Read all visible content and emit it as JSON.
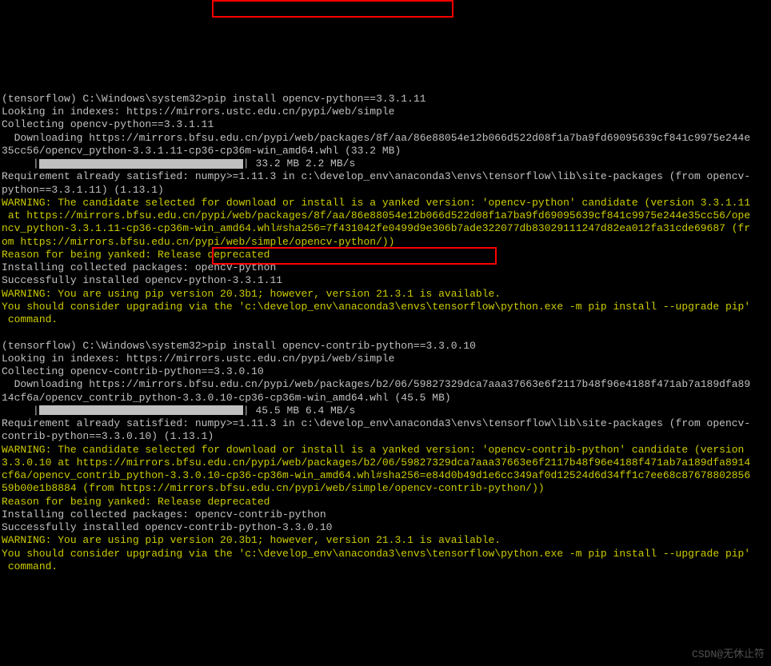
{
  "prompt1": "(tensorflow) C:\\Windows\\system32>",
  "cmd1": "pip install opencv-python==3.3.1.11",
  "lookup1": "Looking in indexes: https://mirrors.ustc.edu.cn/pypi/web/simple",
  "collect1": "Collecting opencv-python==3.3.1.11",
  "dl1a": "  Downloading https://mirrors.bfsu.edu.cn/pypi/web/packages/8f/aa/86e88054e12b066d522d08f1a7ba9fd69095639cf841c9975e244e",
  "dl1b": "35cc56/opencv_python-3.3.1.11-cp36-cp36m-win_amd64.whl (33.2 MB)",
  "prog1": " 33.2 MB 2.2 MB/s",
  "req1a": "Requirement already satisfied: numpy>=1.11.3 in c:\\develop_env\\anaconda3\\envs\\tensorflow\\lib\\site-packages (from opencv-",
  "req1b": "python==3.3.1.11) (1.13.1)",
  "warn1a": "WARNING: The candidate selected for download or install is a yanked version: 'opencv-python' candidate (version 3.3.1.11",
  "warn1b": " at https://mirrors.bfsu.edu.cn/pypi/web/packages/8f/aa/86e88054e12b066d522d08f1a7ba9fd69095639cf841c9975e244e35cc56/ope",
  "warn1c": "ncv_python-3.3.1.11-cp36-cp36m-win_amd64.whl#sha256=7f431042fe0499d9e306b7ade322077db83029111247d82ea012fa31cde69687 (fr",
  "warn1d": "om https://mirrors.bfsu.edu.cn/pypi/web/simple/opencv-python/))",
  "reason1": "Reason for being yanked: Release deprecated",
  "install1": "Installing collected packages: opencv-python",
  "success1": "Successfully installed opencv-python-3.3.1.11",
  "pipwarn1a": "WARNING: You are using pip version 20.3b1; however, version 21.3.1 is available.",
  "pipwarn1b": "You should consider upgrading via the 'c:\\develop_env\\anaconda3\\envs\\tensorflow\\python.exe -m pip install --upgrade pip'",
  "pipwarn1c": " command.",
  "prompt2": "(tensorflow) C:\\Windows\\system32>",
  "cmd2": "pip install opencv-contrib-python==3.3.0.10",
  "lookup2": "Looking in indexes: https://mirrors.ustc.edu.cn/pypi/web/simple",
  "collect2": "Collecting opencv-contrib-python==3.3.0.10",
  "dl2a": "  Downloading https://mirrors.bfsu.edu.cn/pypi/web/packages/b2/06/59827329dca7aaa37663e6f2117b48f96e4188f471ab7a189dfa89",
  "dl2b": "14cf6a/opencv_contrib_python-3.3.0.10-cp36-cp36m-win_amd64.whl (45.5 MB)",
  "prog2": " 45.5 MB 6.4 MB/s",
  "req2a": "Requirement already satisfied: numpy>=1.11.3 in c:\\develop_env\\anaconda3\\envs\\tensorflow\\lib\\site-packages (from opencv-",
  "req2b": "contrib-python==3.3.0.10) (1.13.1)",
  "warn2a": "WARNING: The candidate selected for download or install is a yanked version: 'opencv-contrib-python' candidate (version ",
  "warn2b": "3.3.0.10 at https://mirrors.bfsu.edu.cn/pypi/web/packages/b2/06/59827329dca7aaa37663e6f2117b48f96e4188f471ab7a189dfa8914",
  "warn2c": "cf6a/opencv_contrib_python-3.3.0.10-cp36-cp36m-win_amd64.whl#sha256=e84d0b49d1e6cc349af0d12524d6d34ff1c7ee68c87678802856",
  "warn2d": "59b00e1b8884 (from https://mirrors.bfsu.edu.cn/pypi/web/simple/opencv-contrib-python/))",
  "reason2": "Reason for being yanked: Release deprecated",
  "install2": "Installing collected packages: opencv-contrib-python",
  "success2": "Successfully installed opencv-contrib-python-3.3.0.10",
  "pipwarn2a": "WARNING: You are using pip version 20.3b1; however, version 21.3.1 is available.",
  "pipwarn2b": "You should consider upgrading via the 'c:\\develop_env\\anaconda3\\envs\\tensorflow\\python.exe -m pip install --upgrade pip'",
  "pipwarn2c": " command.",
  "watermark": "CSDN@无休止符",
  "progress_prefix": "     |",
  "progress_suffix": "|"
}
